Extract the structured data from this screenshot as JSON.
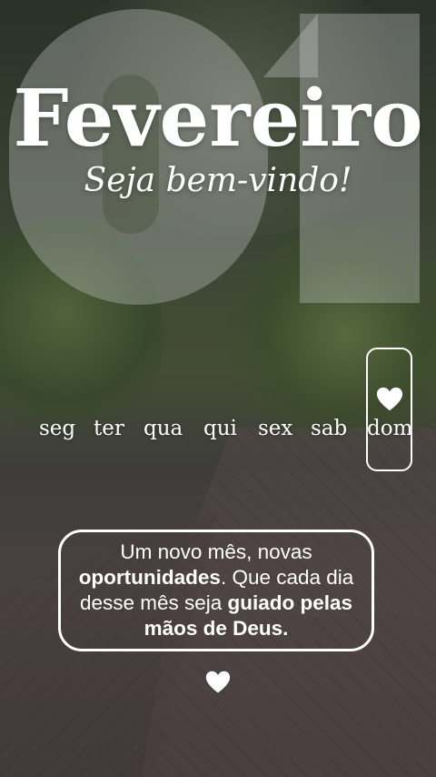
{
  "title": "Fevereiro",
  "subtitle": "Seja bem-vindo!",
  "background_number": "01",
  "weekdays": [
    "seg",
    "ter",
    "qua",
    "qui",
    "sex",
    "sab",
    "dom"
  ],
  "highlighted_day": "dom",
  "message": {
    "part1": "Um novo mês, novas ",
    "bold1": "oportunidades",
    "part2": ". Que cada dia desse mês seja ",
    "bold2": "guiado pelas mãos de Deus."
  },
  "icons": {
    "highlight": "heart-icon",
    "footer": "heart-icon"
  },
  "colors": {
    "text": "#ffffff",
    "heart": "#ffffff"
  }
}
